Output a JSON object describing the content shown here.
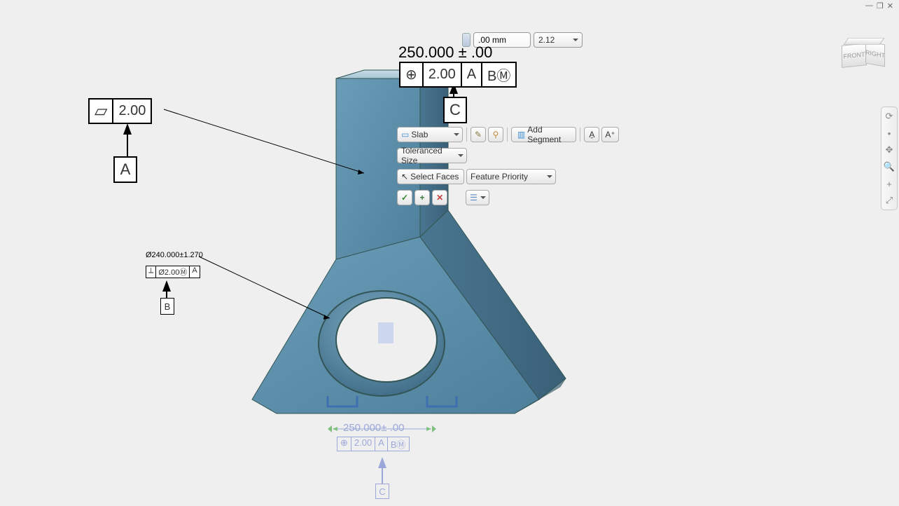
{
  "window": {
    "min": "—",
    "max": "❐",
    "close": "✕"
  },
  "cube": {
    "front": "FRONT",
    "right": "RIGHT"
  },
  "topctrl": {
    "input": ".00 mm",
    "select": "2.12"
  },
  "topdim": "250.000 ± .00",
  "fcf_top": {
    "sym": "⊕",
    "tol": "2.00",
    "a": "A",
    "b": "BⓂ",
    "c": "C"
  },
  "flat": {
    "sym": "▱",
    "val": "2.00",
    "datum": "A"
  },
  "hole": {
    "dim": "Ø240.000±1.270",
    "sym": "⟂",
    "tol": "Ø2.00Ⓜ",
    "ref": "A",
    "datum": "B"
  },
  "panel": {
    "slab": "Slab",
    "addseg": "Add Segment",
    "tolsize": "Toleranced Size",
    "selectfaces": "Select Faces",
    "priority": "Feature Priority",
    "ok": "✓",
    "plus": "+",
    "cancel": "✕"
  },
  "ghost": {
    "dim": "250.000± .00",
    "sym": "⊕",
    "tol": "2.00",
    "a": "A",
    "b": "BⓂ",
    "c": "C"
  },
  "rbar": [
    "⟳",
    "•",
    "✥",
    "🔍",
    "+",
    "⤢"
  ]
}
